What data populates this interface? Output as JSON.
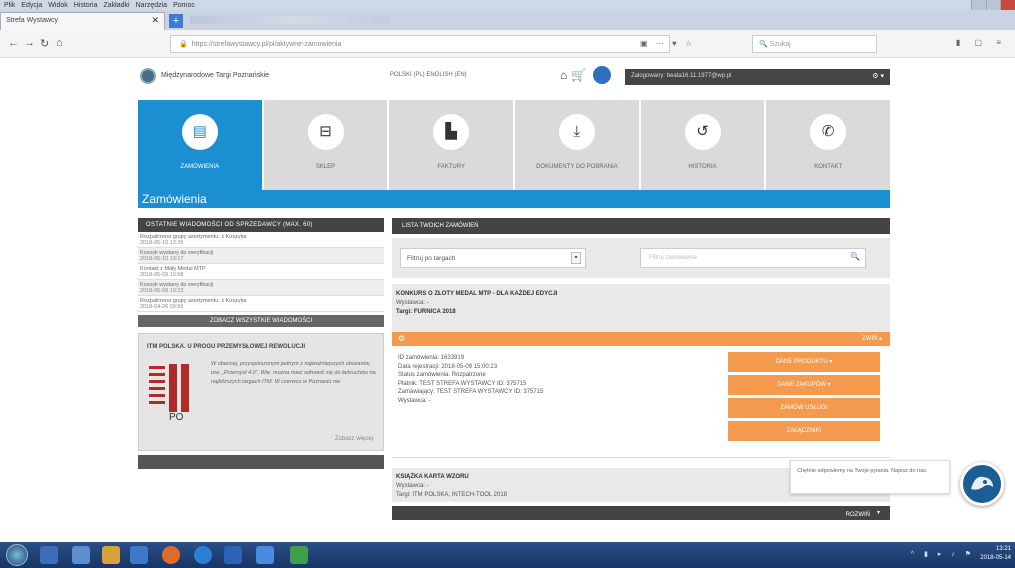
{
  "browser": {
    "menu": [
      "Plik",
      "Edycja",
      "Widok",
      "Historia",
      "Zakładki",
      "Narzędzia",
      "Pomoc"
    ],
    "tab_title": "Strefa Wystawcy",
    "url": "https://strefawystawcy.pl/pl/aktywne-zamowienia",
    "search_placeholder": "Szukaj"
  },
  "site": {
    "name": "Międzynarodowe Targi Poznańskie",
    "languages": "POLSKI (PL)   ENGLISH (EN)",
    "account_label": "Zalogowany:   beata16.11.1977@wp.pl"
  },
  "tiles": [
    {
      "label": "ZAMÓWIENIA"
    },
    {
      "label": "SKLEP"
    },
    {
      "label": "FAKTURY"
    },
    {
      "label": "DOKUMENTY DO POBRANIA"
    },
    {
      "label": "HISTORIA"
    },
    {
      "label": "KONTAKT"
    }
  ],
  "section_title": "Zamówienia",
  "left": {
    "header": "OSTATNIE WIADOMOŚCI OD SPRZEDAWCY (MAX. 60)",
    "notes": [
      {
        "title": "Rozpatrzona grupy asortymentu, z Koszyka",
        "date": "2018-05-10 13:36"
      },
      {
        "title": "Koszyk wysłany do weryfikacji",
        "date": "2018-05-10 13:17"
      },
      {
        "title": "Kontakt z Mały Medal MTP",
        "date": "2018-05-09 10:58"
      },
      {
        "title": "Koszyk wysłany do weryfikacji",
        "date": "2018-05-09 10:23"
      },
      {
        "title": "Rozpatrzona grupy asortymentu, z Koszyka",
        "date": "2018-04-26 09:56"
      }
    ],
    "see_all": "ZOBACZ WSZYSTKIE WIADOMOŚCI",
    "promo_title": "ITM POLSKA. U PROGU PRZEMYSŁOWEJ REWOLUCJI",
    "promo_text": "W obecnej, przyspieszonym jednym z najważniejszych obszarów, tzw. „Przemysł 4.0”, Wie, można mieć odnowić się do łańcuchów na najbliższych targach ITM. W czerwcu w Poznaniu nie",
    "promo_link": "Zobacz więcej"
  },
  "right": {
    "header": "LISTA TWOICH ZAMÓWIEŃ",
    "filter_value": "Filtruj po targach",
    "search_placeholder": "Filtruj zamówienie",
    "order1": {
      "title": "KONKURS O ZŁOTY MEDAL MTP - DLA KAŻDEJ EDYCJI",
      "exhibitor": "Wystawca: -",
      "fair": "Targi: FURNICA 2018"
    },
    "toggle_label": "ZWIŃ",
    "details": {
      "id": "ID zamówienia: 1633919",
      "date": "Data rejestracji: 2018-05-09 15:00:23",
      "status": "Status zamówienia: Rozpatrzone",
      "payer": "Płatnik: TEST STREFA WYSTAWCY ID: 375715",
      "orderer": "Zamawiający: TEST STREFA WYSTAWCY ID: 375715",
      "exhibitor": "Wystawca: -"
    },
    "actions": [
      "DANE PRODUKTU ▾",
      "DANE ZAKUPÓW ▾",
      "ZAMÓW USŁUGI",
      "ZAŁĄCZNIKI"
    ],
    "order2": {
      "title": "KSIĄŻKA KARTA WZORU",
      "exhibitor": "Wystawca: -",
      "fair": "Targi: ITM POLSKA, INTECH-TOOL 2018"
    },
    "footer_toggle": "ROZWIŃ"
  },
  "chat": {
    "text": "Chętnie odpowiemy na Twoje pytania. Napisz do nas."
  },
  "taskbar": {
    "time": "13:21",
    "date": "2018-05-14"
  },
  "colors": {
    "accent_blue": "#1b8fd2",
    "orange": "#f39a4f",
    "dark_header": "#444444"
  }
}
